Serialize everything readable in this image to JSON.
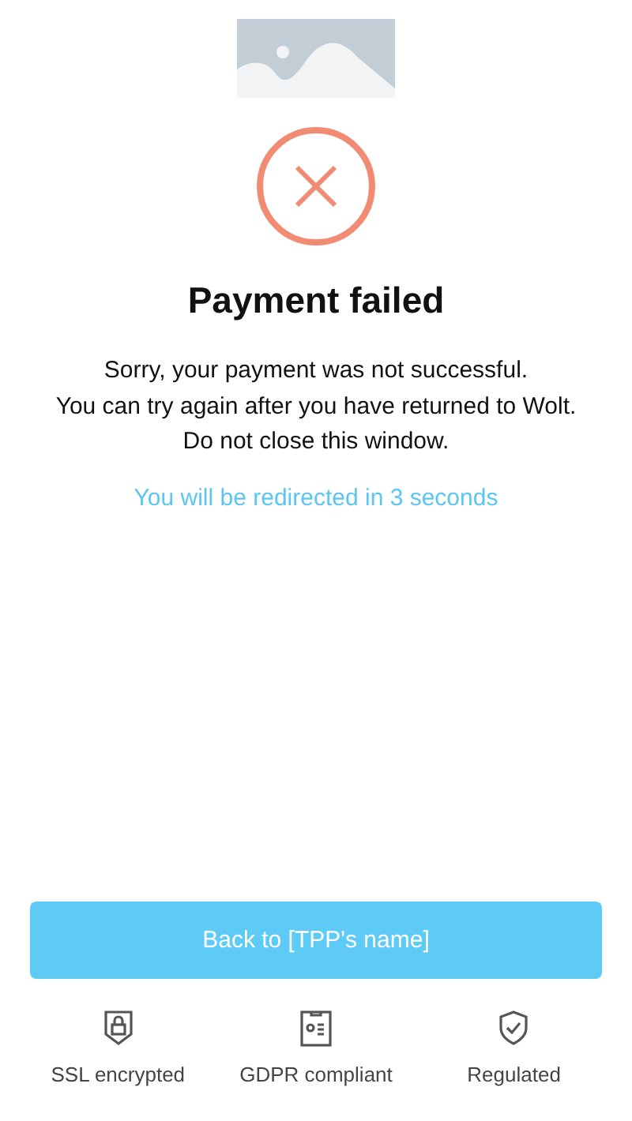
{
  "title": "Payment failed",
  "message": [
    "Sorry, your payment was not successful.",
    "You can try again after you have returned to Wolt.",
    "Do not close this window."
  ],
  "redirect": "You will be redirected in 3 seconds",
  "button": "Back to [TPP's name]",
  "badges": [
    {
      "kind": "lock",
      "label": "SSL encrypted"
    },
    {
      "kind": "document",
      "label": "GDPR compliant"
    },
    {
      "kind": "check",
      "label": "Regulated"
    }
  ]
}
